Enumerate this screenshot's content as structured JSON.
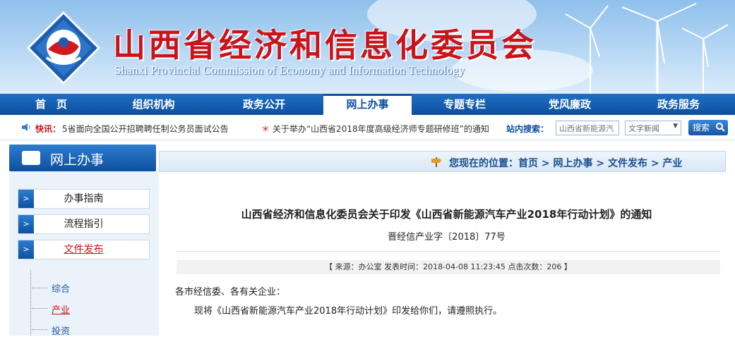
{
  "header": {
    "title": "山西省经济和信息化委员会",
    "subtitle": "Shanxi Provincial Commission of Economy and Information Technology"
  },
  "nav": {
    "items": [
      "首　页",
      "组织机构",
      "政务公开",
      "网上办事",
      "专题专栏",
      "党风廉政",
      "政务服务"
    ],
    "active": "网上办事"
  },
  "ticker": {
    "label": "快讯：",
    "items": [
      "5省面向全国公开招聘聘任制公务员面试公告",
      "关于举办“山西省2018年度高级经济师专题研修班”的通知"
    ]
  },
  "search": {
    "label": "站内搜索：",
    "input_value": "山西省新能源汽",
    "select_value": "文字新闻",
    "button_label": "搜索"
  },
  "sidebar": {
    "title": "网上办事",
    "items": [
      "办事指南",
      "流程指引",
      "文件发布"
    ],
    "subitems": [
      "综合",
      "产业",
      "投资"
    ]
  },
  "breadcrumb": "您现在的位置：首页 > 网上办事 > 文件发布 > 产业",
  "article": {
    "title": "山西省经济和信息化委员会关于印发《山西省新能源汽车产业2018年行动计划》的通知",
    "doc_no": "晋经信产业字〔2018〕77号",
    "meta": "【 来源：办公室     发表时间：2018-04-08 11:23:45   点击次数：206 】",
    "greeting": "各市经信委、各有关企业：",
    "body": "现将《山西省新能源汽车产业2018年行动计划》印发给你们，请遵照执行。"
  },
  "colors": {
    "brand_blue": "#0d4f9e",
    "brand_red": "#c8141a"
  }
}
